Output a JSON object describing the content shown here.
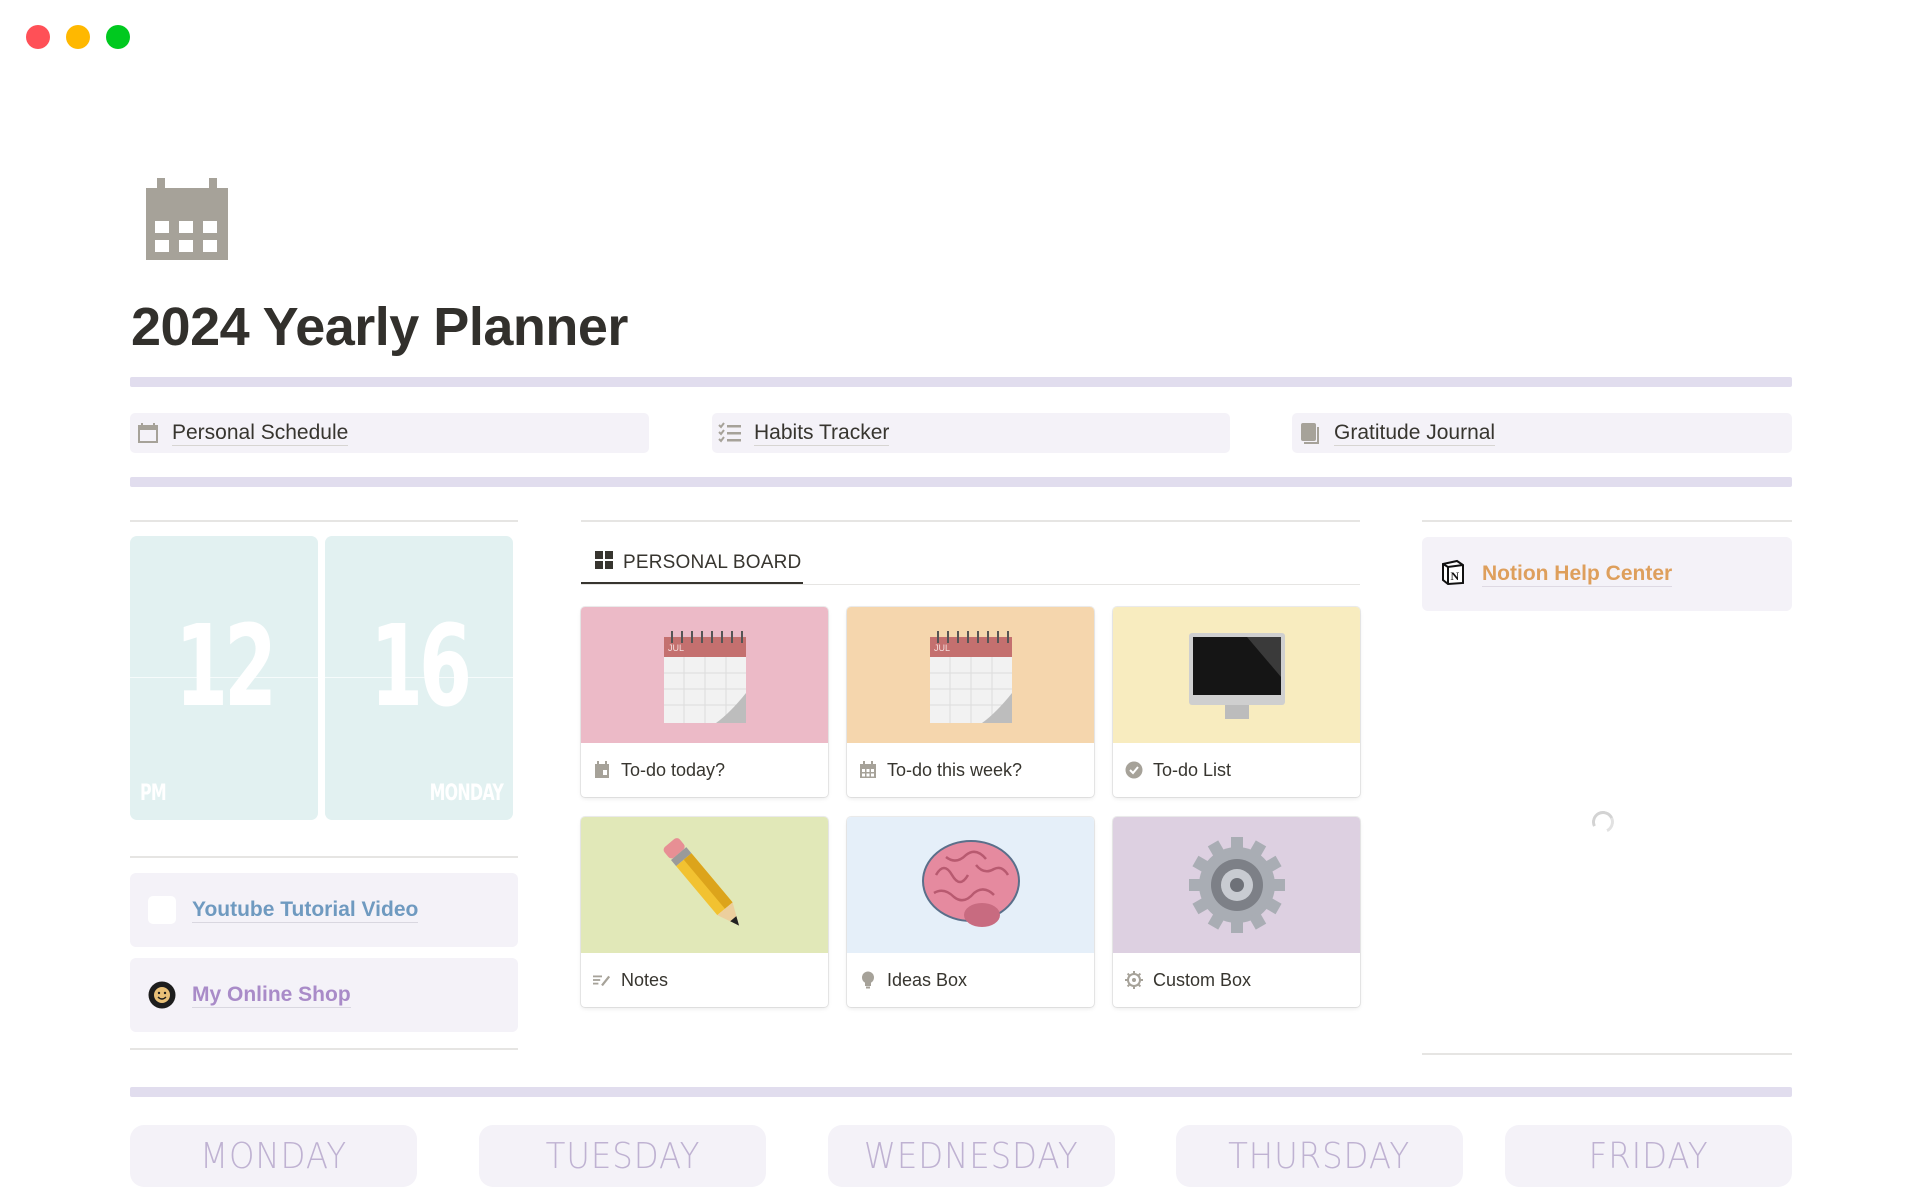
{
  "window": {
    "controls": [
      "close",
      "minimize",
      "maximize"
    ]
  },
  "page": {
    "icon": "calendar-icon",
    "title": "2024 Yearly Planner"
  },
  "top_links": [
    {
      "label": "Personal Schedule",
      "icon": "calendar-icon"
    },
    {
      "label": "Habits Tracker",
      "icon": "checklist-icon"
    },
    {
      "label": "Gratitude Journal",
      "icon": "book-icon"
    }
  ],
  "clock": {
    "hour": "12",
    "minute": "16",
    "period": "PM",
    "weekday": "MONDAY"
  },
  "side_links": [
    {
      "label": "Youtube Tutorial Video",
      "icon": "blank-square-icon",
      "color": "#6f9ac0"
    },
    {
      "label": "My Online Shop",
      "icon": "smiley-badge-icon",
      "color": "#a98bc8"
    }
  ],
  "board": {
    "tab_label": "PERSONAL BOARD",
    "tab_icon": "grid-icon",
    "cards": [
      {
        "label": "To-do today?",
        "icon": "calendar-page-icon",
        "cover_icon": "spiral-calendar",
        "cover_color": "#ecbac7"
      },
      {
        "label": "To-do this week?",
        "icon": "calendar-grid-icon",
        "cover_icon": "spiral-calendar",
        "cover_color": "#f5d6ad"
      },
      {
        "label": "To-do List",
        "icon": "check-circle-icon",
        "cover_icon": "monitor",
        "cover_color": "#f8ecbf"
      },
      {
        "label": "Notes",
        "icon": "edit-lines-icon",
        "cover_icon": "pencil",
        "cover_color": "#e1e8b8"
      },
      {
        "label": "Ideas Box",
        "icon": "lightbulb-icon",
        "cover_icon": "brain",
        "cover_color": "#e5eff9"
      },
      {
        "label": "Custom Box",
        "icon": "gear-icon",
        "cover_icon": "gear",
        "cover_color": "#ddd0e1"
      }
    ]
  },
  "help": {
    "label": "Notion Help Center",
    "icon": "notion-logo-icon"
  },
  "weekdays": [
    "MONDAY",
    "TUESDAY",
    "WEDNESDAY",
    "THURSDAY",
    "FRIDAY"
  ]
}
